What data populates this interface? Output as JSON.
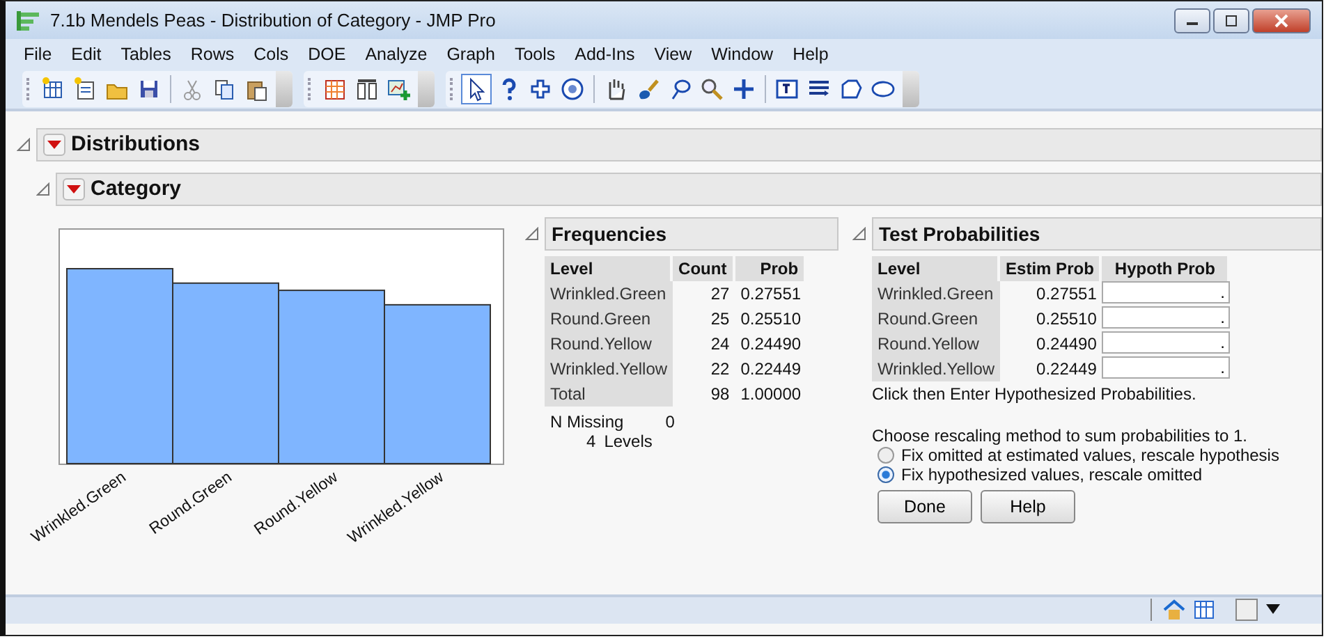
{
  "window": {
    "title": "7.1b Mendels Peas - Distribution of Category - JMP Pro"
  },
  "menu": [
    "File",
    "Edit",
    "Tables",
    "Rows",
    "Cols",
    "DOE",
    "Analyze",
    "Graph",
    "Tools",
    "Add-Ins",
    "View",
    "Window",
    "Help"
  ],
  "toolbar": {
    "pointer_selected": true
  },
  "distributions": {
    "title": "Distributions",
    "expanded": true
  },
  "category": {
    "title": "Category",
    "expanded": true,
    "chart": {
      "axis_labels": [
        "Wrinkled.Green",
        "Round.Green",
        "Round.Yellow",
        "Wrinkled.Yellow"
      ]
    },
    "frequencies": {
      "title": "Frequencies",
      "columns": [
        "Level",
        "Count",
        "Prob"
      ],
      "rows": [
        {
          "level": "Wrinkled.Green",
          "count": "27",
          "prob": "0.27551"
        },
        {
          "level": "Round.Green",
          "count": "25",
          "prob": "0.25510"
        },
        {
          "level": "Round.Yellow",
          "count": "24",
          "prob": "0.24490"
        },
        {
          "level": "Wrinkled.Yellow",
          "count": "22",
          "prob": "0.22449"
        },
        {
          "level": "Total",
          "count": "98",
          "prob": "1.00000"
        }
      ],
      "n_missing_label": "N Missing",
      "n_missing": "0",
      "levels_count": "4",
      "levels_label": "Levels"
    },
    "test_probabilities": {
      "title": "Test Probabilities",
      "columns": [
        "Level",
        "Estim Prob",
        "Hypoth Prob"
      ],
      "rows": [
        {
          "level": "Wrinkled.Green",
          "estim": "0.27551",
          "hypoth": "."
        },
        {
          "level": "Round.Green",
          "estim": "0.25510",
          "hypoth": "."
        },
        {
          "level": "Round.Yellow",
          "estim": "0.24490",
          "hypoth": "."
        },
        {
          "level": "Wrinkled.Yellow",
          "estim": "0.22449",
          "hypoth": "."
        }
      ],
      "hint": "Click then Enter Hypothesized Probabilities.",
      "rescale_prompt": "Choose rescaling method to sum probabilities to 1.",
      "options": [
        {
          "label": "Fix omitted at estimated values, rescale hypothesis",
          "selected": false
        },
        {
          "label": "Fix hypothesized values, rescale omitted",
          "selected": true
        }
      ],
      "buttons": [
        "Done",
        "Help"
      ]
    }
  }
}
